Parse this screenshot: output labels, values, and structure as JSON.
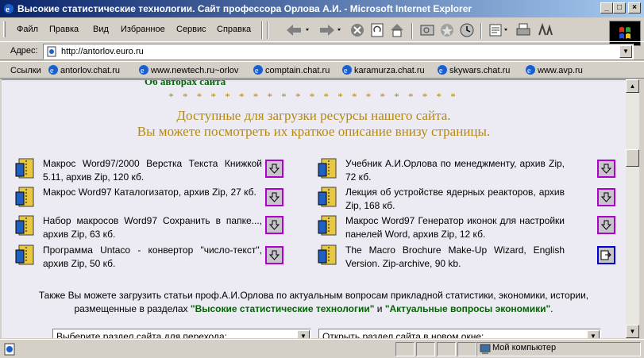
{
  "window": {
    "title": "Высокие статистические технологии. Сайт профессора Орлова А.И. - Microsoft Internet Explorer",
    "min_label": "_",
    "max_label": "□",
    "close_label": "×"
  },
  "menu": [
    {
      "label": "Файл"
    },
    {
      "label": "Правка"
    },
    {
      "label": "Вид"
    },
    {
      "label": "Избранное"
    },
    {
      "label": "Сервис"
    },
    {
      "label": "Справка"
    }
  ],
  "address": {
    "label": "Адрес:",
    "url": "http://antorlov.euro.ru"
  },
  "links": {
    "label": "Ссылки",
    "items": [
      "antorlov.chat.ru",
      "www.newtech.ru~orlov",
      "comptain.chat.ru",
      "karamurza.chat.ru",
      "skywars.chat.ru",
      "www.avp.ru"
    ]
  },
  "page": {
    "cut_heading": "Об авторах сайта",
    "stars": "* * * * * * * * * * * * * * * * * * * * *",
    "heading1": "Доступные для загрузки ресурсы нашего сайта.",
    "heading2": "Вы можете посмотреть их краткое описание внизу страницы.",
    "resources_left": [
      "Макрос Word97/2000 Верстка Текста Книжкой 5.11, архив Zip, 120 кб.",
      "Макрос Word97 Каталогизатор, архив Zip, 27 кб.",
      "Набор макросов Word97 Сохранить в папке..., архив Zip, 63 кб.",
      "Программа Untaco - конвертор \"число-текст\", архив Zip, 50 кб."
    ],
    "resources_right": [
      "Учебник А.И.Орлова по менеджменту, архив Zip, 72 кб.",
      "Лекция об устройстве ядерных реакторов, архив Zip, 168 кб.",
      "Макрос Word97 Генератор иконок для настройки панелей Word, архив Zip, 12 кб.",
      "The Macro Brochure Make-Up Wizard, English Version. Zip-archive, 90 kb."
    ],
    "para_line1": "Также Вы можете загрузить статьи проф.А.И.Орлова по актуальным вопросам прикладной статистики, экономики, истории,",
    "para_line2_prefix": "размещенные в разделах ",
    "para_link1": "\"Высокие статистические технологии\"",
    "para_and": " и ",
    "para_link2": "\"Актуальные вопросы экономики\"",
    "para_end": ".",
    "select1": "Выберите раздел сайта для перехода:",
    "select2": "Открыть раздел сайта в новом окне:"
  },
  "status": {
    "zone": "Мой компьютер"
  },
  "colors": {
    "accent_gold": "#b58a10",
    "link_green": "#006600",
    "titlebar_start": "#0a246a",
    "titlebar_end": "#a6caf0"
  }
}
